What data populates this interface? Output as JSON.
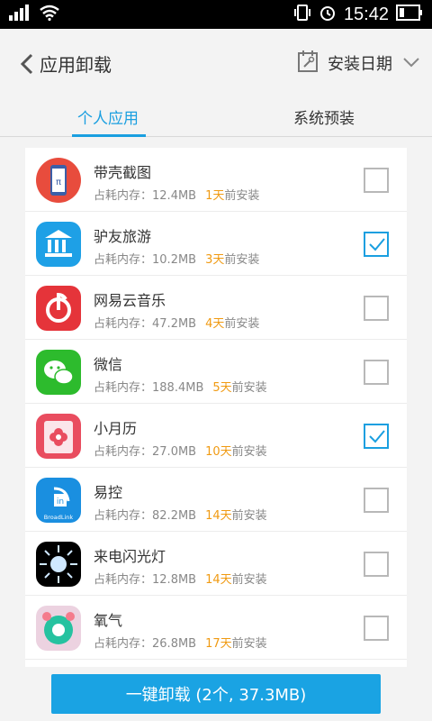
{
  "statusbar": {
    "time": "15:42"
  },
  "header": {
    "title": "应用卸载",
    "sort_label": "安装日期"
  },
  "tabs": [
    {
      "label": "个人应用"
    },
    {
      "label": "系统预装"
    }
  ],
  "memory_prefix": "占耗内存：",
  "installed_suffix": "前安装",
  "apps": [
    {
      "name": "带壳截图",
      "memory": "12.4MB",
      "days": "1天",
      "checked": false
    },
    {
      "name": "驴友旅游",
      "memory": "10.2MB",
      "days": "3天",
      "checked": true
    },
    {
      "name": "网易云音乐",
      "memory": "47.2MB",
      "days": "4天",
      "checked": false
    },
    {
      "name": "微信",
      "memory": "188.4MB",
      "days": "5天",
      "checked": false
    },
    {
      "name": "小月历",
      "memory": "27.0MB",
      "days": "10天",
      "checked": true
    },
    {
      "name": "易控",
      "memory": "82.2MB",
      "days": "14天",
      "checked": false
    },
    {
      "name": "来电闪光灯",
      "memory": "12.8MB",
      "days": "14天",
      "checked": false
    },
    {
      "name": "氧气",
      "memory": "26.8MB",
      "days": "17天",
      "checked": false
    }
  ],
  "icons": {
    "app0": {
      "color": "#e84c3d",
      "label": "π"
    },
    "app1": {
      "color": "#1ea0e6"
    },
    "app2": {
      "color": "#e5343a"
    },
    "app3": {
      "color": "#2dbb2d"
    },
    "app4": {
      "color": "#e94d5f"
    },
    "app5": {
      "color": "#1a8fe0",
      "label": "BroadLink"
    },
    "app6": {
      "color": "#000000"
    },
    "app7": {
      "color": "#ecd2e0"
    }
  },
  "uninstall_button": {
    "label": "一键卸载 (2个, 37.3MB)"
  }
}
